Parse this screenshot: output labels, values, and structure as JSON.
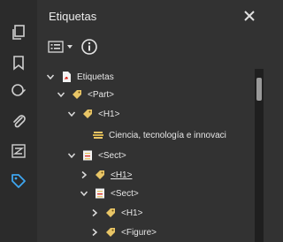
{
  "panel": {
    "title": "Etiquetas"
  },
  "toolbar": {
    "options_icon": "list-options-icon",
    "info_icon": "info-icon"
  },
  "rail": {
    "items": [
      {
        "icon": "copy-pages-icon"
      },
      {
        "icon": "bookmark-icon"
      },
      {
        "icon": "edit-sign-icon"
      },
      {
        "icon": "attachment-icon"
      },
      {
        "icon": "layers-icon"
      },
      {
        "icon": "tag-icon",
        "active": true
      }
    ]
  },
  "tree": {
    "root": "Etiquetas",
    "part": "<Part>",
    "h1_a": "<H1>",
    "text": "Ciencia, tecnología e innovaci",
    "sect_a": "<Sect>",
    "h1_b": "<H1>",
    "sect_b": "<Sect>",
    "h1_c": "<H1>",
    "figure": "<Figure>"
  },
  "colors": {
    "active_icon": "#3ea6f0",
    "tag": "#e8c566",
    "pdf": "#d9261c"
  }
}
